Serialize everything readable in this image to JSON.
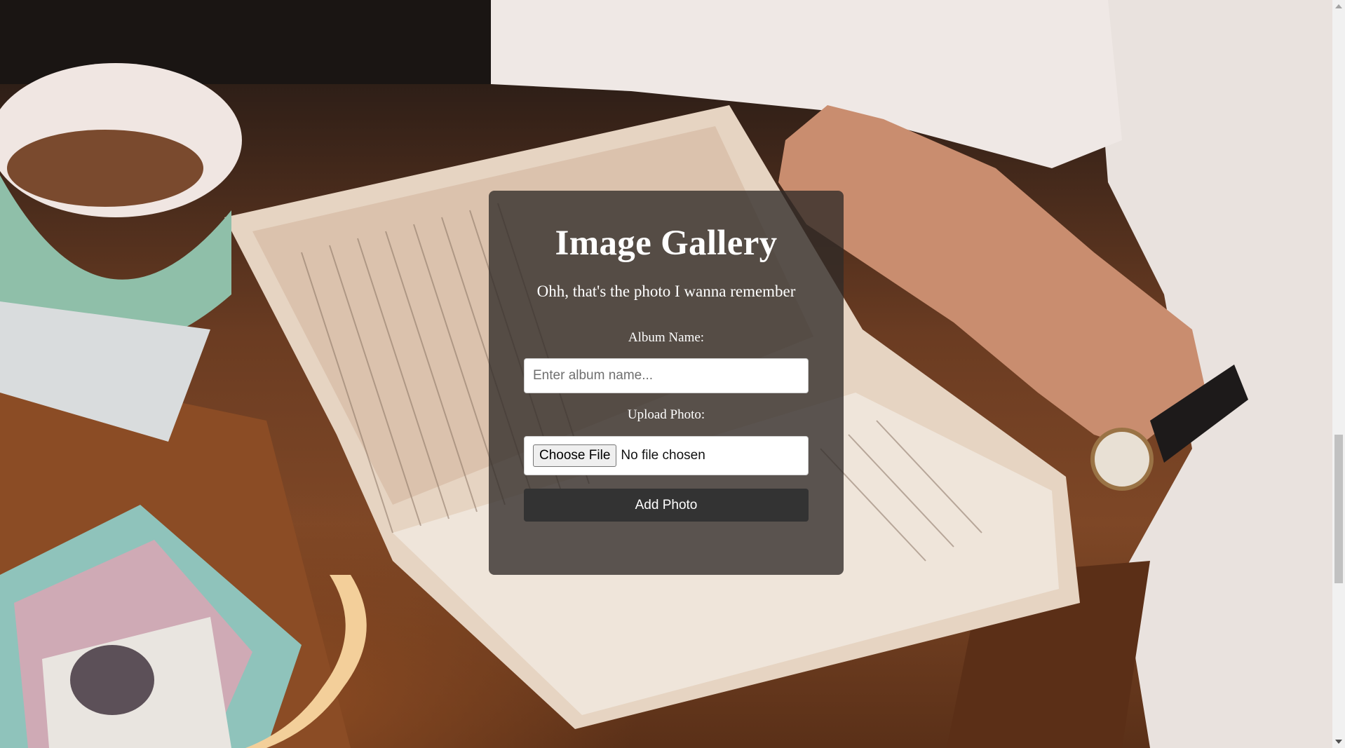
{
  "page": {
    "title": "Image Gallery",
    "subtitle": "Ohh, that's the photo I wanna remember"
  },
  "form": {
    "album_label": "Album Name:",
    "album_placeholder": "Enter album name...",
    "album_value": "",
    "upload_label": "Upload Photo:",
    "choose_file_label": "Choose File",
    "file_status": "No file chosen",
    "submit_label": "Add Photo"
  },
  "colors": {
    "panel_bg": "#302a28",
    "button_bg": "#333333",
    "text": "#ffffff"
  },
  "background": {
    "icon": "background-photo"
  }
}
